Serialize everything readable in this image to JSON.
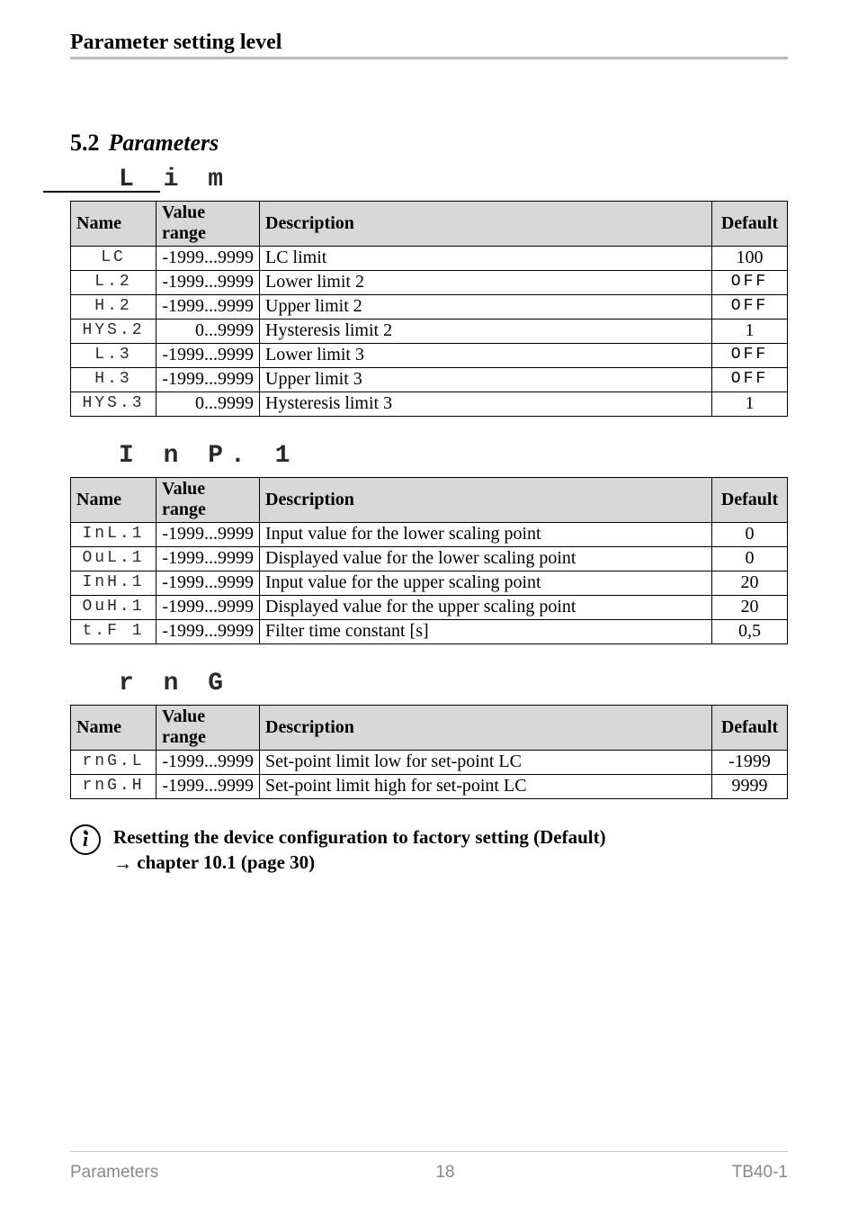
{
  "header": {
    "running_head": "Parameter setting level"
  },
  "section": {
    "number": "5.2",
    "title": "Parameters"
  },
  "groups": [
    {
      "heading_seg": "L i m",
      "columns": [
        "Name",
        "Value range",
        "Description",
        "Default"
      ],
      "rows": [
        {
          "name_seg": "LC",
          "range": "-1999...9999",
          "desc": "LC limit",
          "default": "100",
          "default_seg": false
        },
        {
          "name_seg": "L.2",
          "range": "-1999...9999",
          "desc": "Lower limit 2",
          "default": "OFF",
          "default_seg": true
        },
        {
          "name_seg": "H.2",
          "range": "-1999...9999",
          "desc": "Upper limit 2",
          "default": "OFF",
          "default_seg": true
        },
        {
          "name_seg": "HYS.2",
          "range": "0...9999",
          "desc": "Hysteresis limit 2",
          "default": "1",
          "default_seg": false
        },
        {
          "name_seg": "L.3",
          "range": "-1999...9999",
          "desc": "Lower limit 3",
          "default": "OFF",
          "default_seg": true
        },
        {
          "name_seg": "H.3",
          "range": "-1999...9999",
          "desc": "Upper limit 3",
          "default": "OFF",
          "default_seg": true
        },
        {
          "name_seg": "HYS.3",
          "range": "0...9999",
          "desc": "Hysteresis limit 3",
          "default": "1",
          "default_seg": false
        }
      ]
    },
    {
      "heading_seg": "I n P. 1",
      "columns": [
        "Name",
        "Value range",
        "Description",
        "Default"
      ],
      "rows": [
        {
          "name_seg": "InL.1",
          "range": "-1999...9999",
          "desc": "Input value for the lower scaling point",
          "default": "0",
          "default_seg": false
        },
        {
          "name_seg": "OuL.1",
          "range": "-1999...9999",
          "desc": "Displayed value for the lower scaling point",
          "default": "0",
          "default_seg": false
        },
        {
          "name_seg": "InH.1",
          "range": "-1999...9999",
          "desc": "Input value for the upper scaling point",
          "default": "20",
          "default_seg": false
        },
        {
          "name_seg": "OuH.1",
          "range": "-1999...9999",
          "desc": "Displayed value for the upper scaling point",
          "default": "20",
          "default_seg": false
        },
        {
          "name_seg": "t.F 1",
          "range": "-1999...9999",
          "desc": "Filter time constant [s]",
          "default": "0,5",
          "default_seg": false
        }
      ]
    },
    {
      "heading_seg": "r n G",
      "columns": [
        "Name",
        "Value range",
        "Description",
        "Default"
      ],
      "rows": [
        {
          "name_seg": "rnG.L",
          "range": "-1999...9999",
          "desc": "Set-point limit low for set-point LC",
          "default": "-1999",
          "default_seg": false
        },
        {
          "name_seg": "rnG.H",
          "range": "-1999...9999",
          "desc": "Set-point limit high for set-point LC",
          "default": "9999",
          "default_seg": false
        }
      ]
    }
  ],
  "note": {
    "line1": "Resetting the device configuration to factory setting (Default)",
    "arrow": "→",
    "line2": " chapter  10.1  (page 30)"
  },
  "footer": {
    "left": "Parameters",
    "center": "18",
    "right": "TB40-1"
  }
}
